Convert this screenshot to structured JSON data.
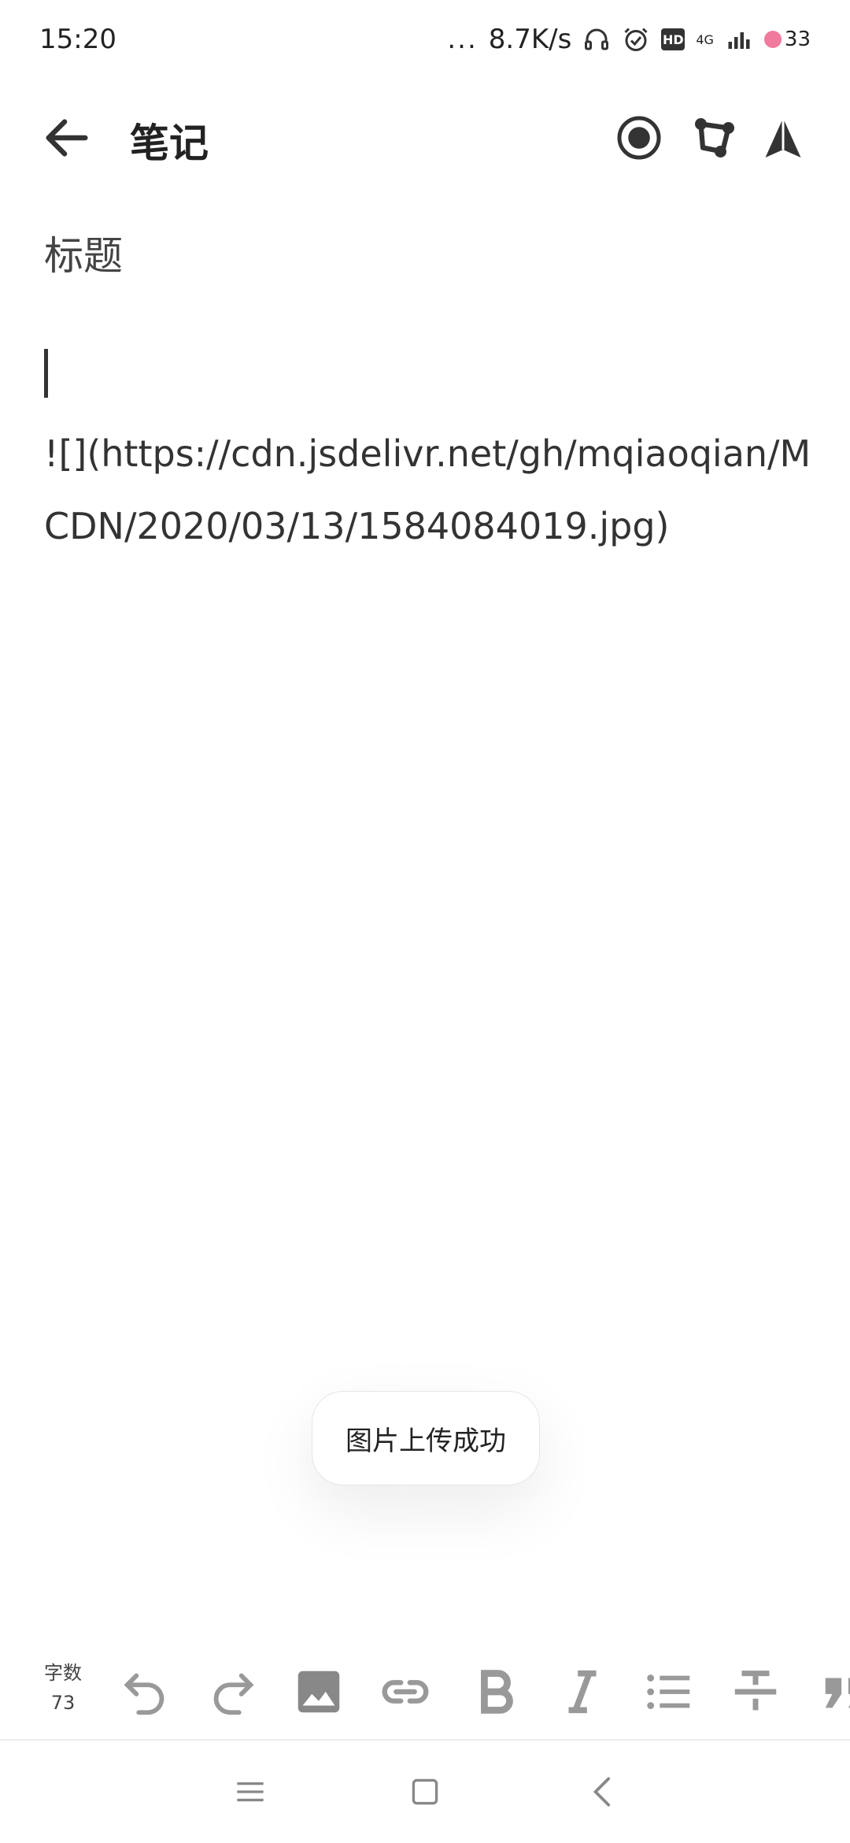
{
  "status_bar": {
    "time": "15:20",
    "net_speed": "8.7K/s",
    "dots": "...",
    "hd": "HD",
    "network": "4G",
    "battery": "33"
  },
  "app_bar": {
    "title": "笔记"
  },
  "editor": {
    "title_placeholder": "标题",
    "content": "![](https://cdn.jsdelivr.net/gh/mqiaoqian/MCDN/2020/03/13/1584084019.jpg)"
  },
  "toast": {
    "message": "图片上传成功"
  },
  "toolbar": {
    "word_count_label": "字数",
    "word_count_value": "73",
    "tools": [
      "undo-icon",
      "redo-icon",
      "image-icon",
      "link-icon",
      "bold-icon",
      "italic-icon",
      "list-icon",
      "strikethrough-icon",
      "quote-icon"
    ]
  },
  "nav_bar": {
    "buttons": [
      "menu-icon",
      "home-icon",
      "back-icon"
    ]
  }
}
